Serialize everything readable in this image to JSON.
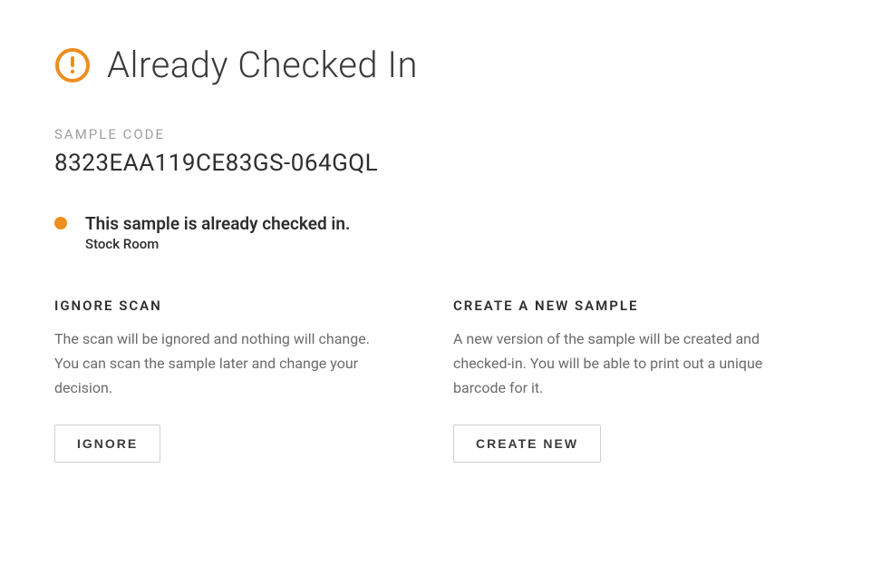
{
  "header": {
    "title": "Already Checked In",
    "icon": "alert-circle-icon",
    "icon_color": "#ee8e1e"
  },
  "sample_code": {
    "label": "SAMPLE CODE",
    "value": "8323EAA119CE83GS-064GQL"
  },
  "status": {
    "dot_color": "#ee8e1e",
    "message": "This sample is already checked in.",
    "location": "Stock Room"
  },
  "options": [
    {
      "title": "IGNORE SCAN",
      "description": "The scan will be ignored and nothing will change. You can scan the sample later and change your decision.",
      "button_label": "IGNORE"
    },
    {
      "title": "CREATE A NEW SAMPLE",
      "description": "A new version of the sample will be created and checked-in. You will be able to print out a unique barcode for it.",
      "button_label": "CREATE NEW"
    }
  ]
}
